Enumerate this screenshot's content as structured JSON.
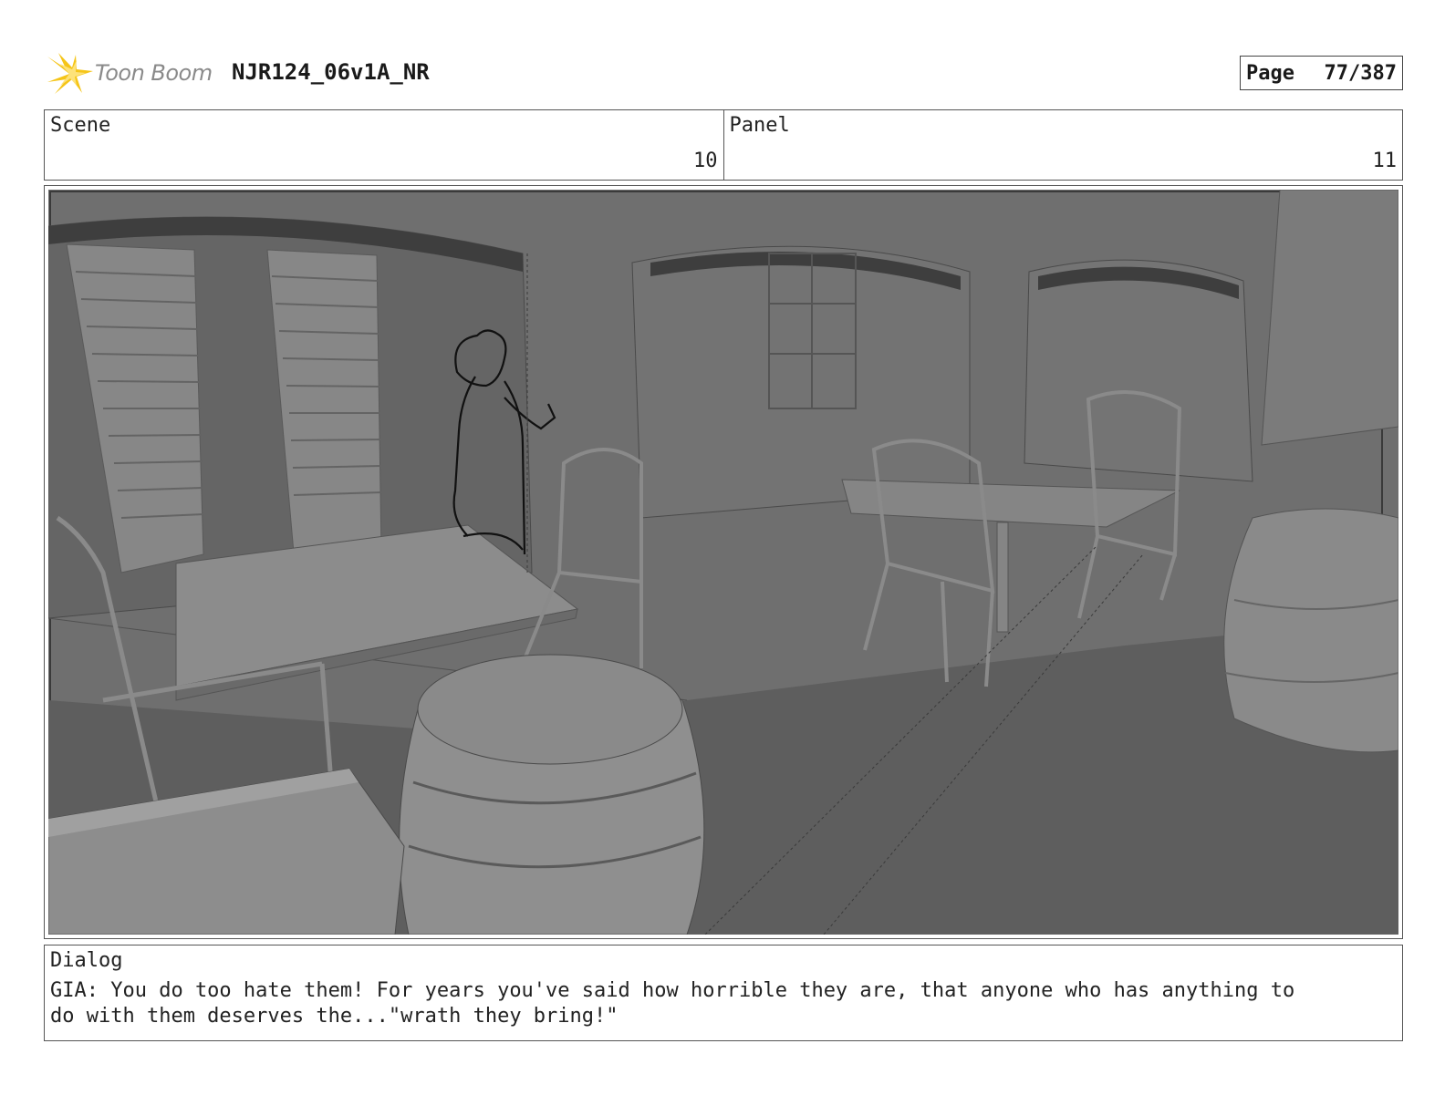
{
  "header": {
    "logo_text": "Toon Boom",
    "title": "NJR124_06v1A_NR",
    "page_label": "Page",
    "page_number": "77/387"
  },
  "info": {
    "scene_label": "Scene",
    "scene_value": "10",
    "panel_label": "Panel",
    "panel_value": "11"
  },
  "dialog": {
    "label": "Dialog",
    "text": "GIA: You do too hate them! For years you've said how horrible they are, that anyone who has anything to\ndo with them deserves the...\"wrath they bring!\""
  },
  "colors": {
    "logo_star": "#f5c518",
    "render_background": "#6e6e6e",
    "render_floor": "#5f5f5f",
    "sketch_line": "#111111"
  },
  "icons": {
    "logo": "toon-boom-star-logo"
  }
}
